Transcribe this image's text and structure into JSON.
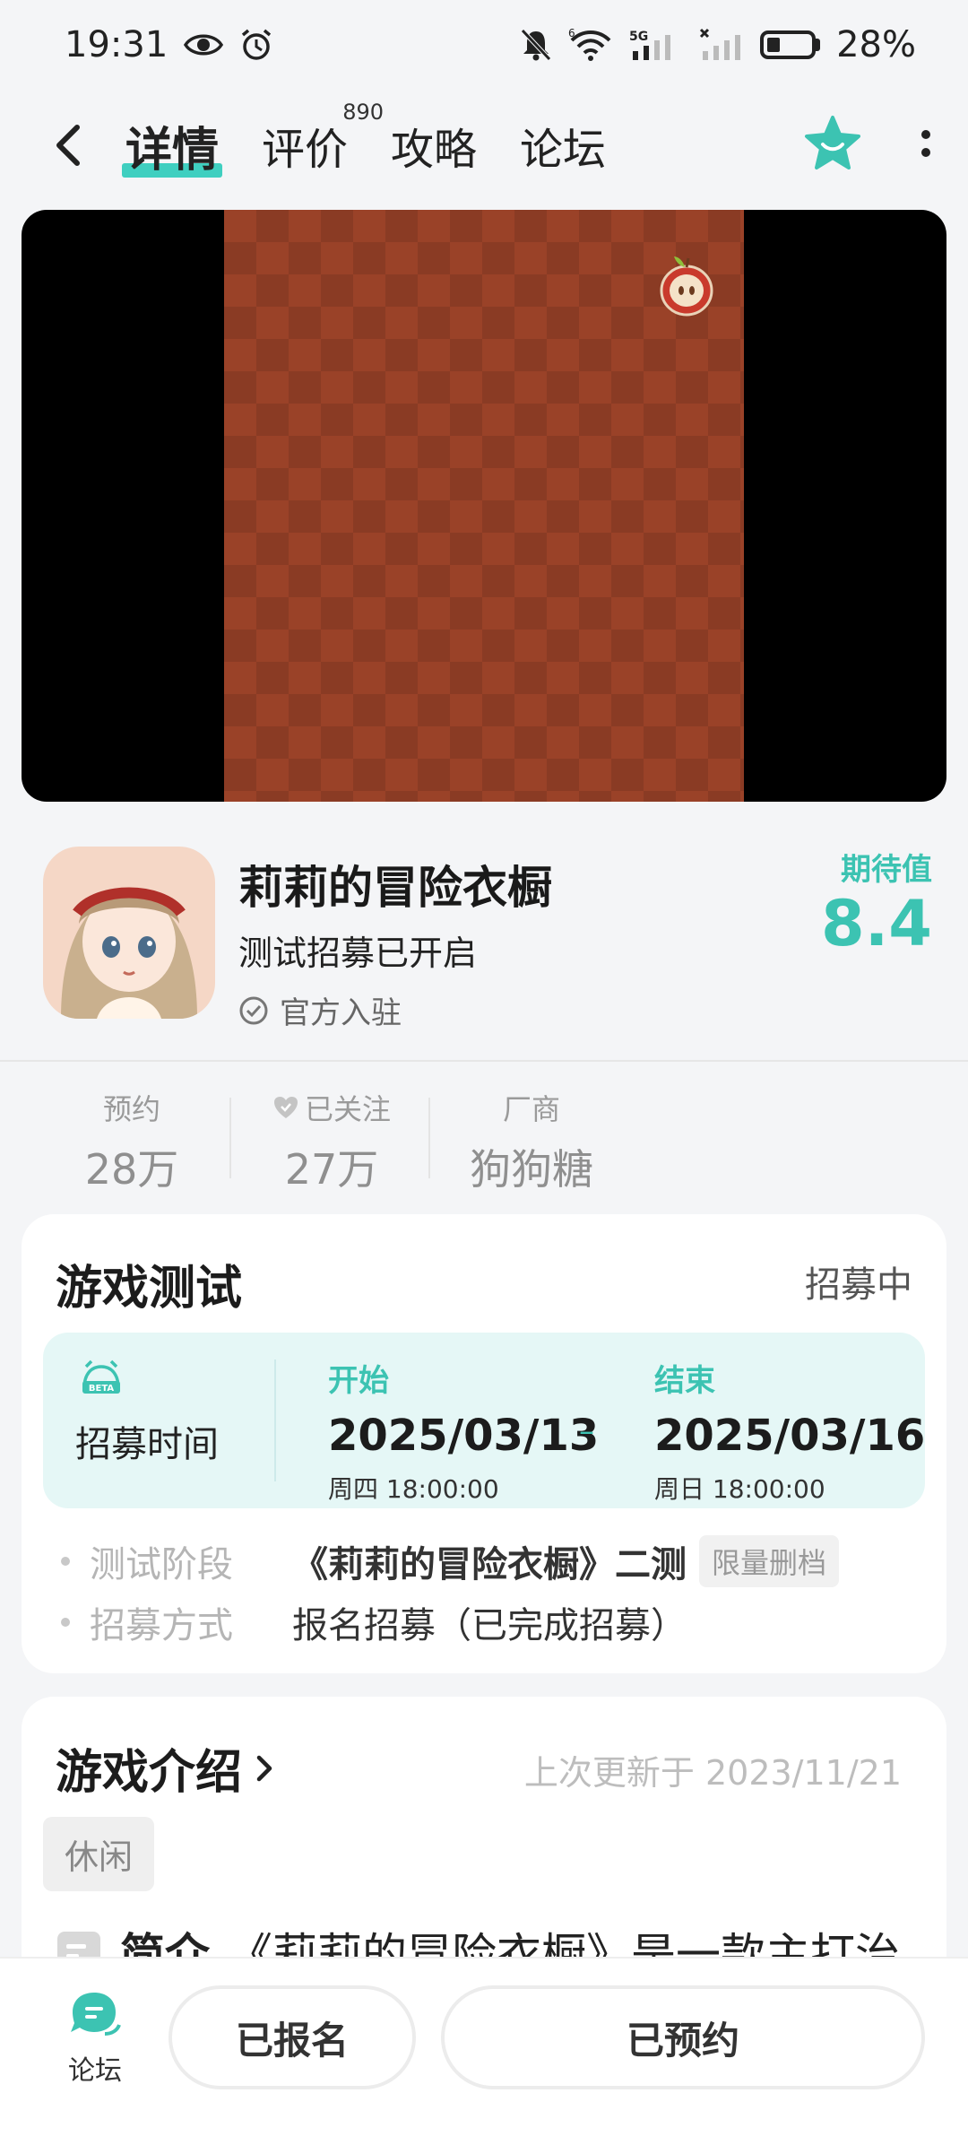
{
  "status_bar": {
    "time": "19:31",
    "battery": "28%",
    "signal_label": "5G",
    "wifi_label": "6"
  },
  "nav": {
    "tabs": [
      {
        "label": "详情"
      },
      {
        "label": "评价",
        "badge": "890"
      },
      {
        "label": "攻略"
      },
      {
        "label": "论坛"
      }
    ]
  },
  "game": {
    "title": "莉莉的冒险衣橱",
    "subtitle": "测试招募已开启",
    "official": "官方入驻",
    "expect_label": "期待值",
    "expect_value": "8.4"
  },
  "stats": [
    {
      "label": "预约",
      "value": "28万"
    },
    {
      "label": "已关注",
      "value": "27万"
    },
    {
      "label": "厂商",
      "value": "狗狗糖"
    }
  ],
  "test": {
    "header": "游戏测试",
    "status": "招募中",
    "recruit_label": "招募时间",
    "beta_label": "BETA",
    "start": {
      "label": "开始",
      "date": "2025/03/13",
      "weekday_time": "周四  18:00:00"
    },
    "end": {
      "label": "结束",
      "date": "2025/03/16",
      "weekday_time": "周日  18:00:00"
    },
    "stage_label": "测试阶段",
    "stage_value": "《莉莉的冒险衣橱》二测",
    "stage_tag": "限量删档",
    "method_label": "招募方式",
    "method_value": "报名招募（已完成招募）"
  },
  "intro": {
    "title": "游戏介绍",
    "updated": "上次更新于 2023/11/21",
    "genre": "休闲",
    "summary_label": "简介",
    "summary_text": "《莉莉的冒险衣橱》是一款主打治"
  },
  "bottom": {
    "forum_label": "论坛",
    "signed_label": "已报名",
    "reserved_label": "已预约"
  },
  "colors": {
    "accent": "#3cc3b2",
    "media_pattern": "#9a4228"
  }
}
